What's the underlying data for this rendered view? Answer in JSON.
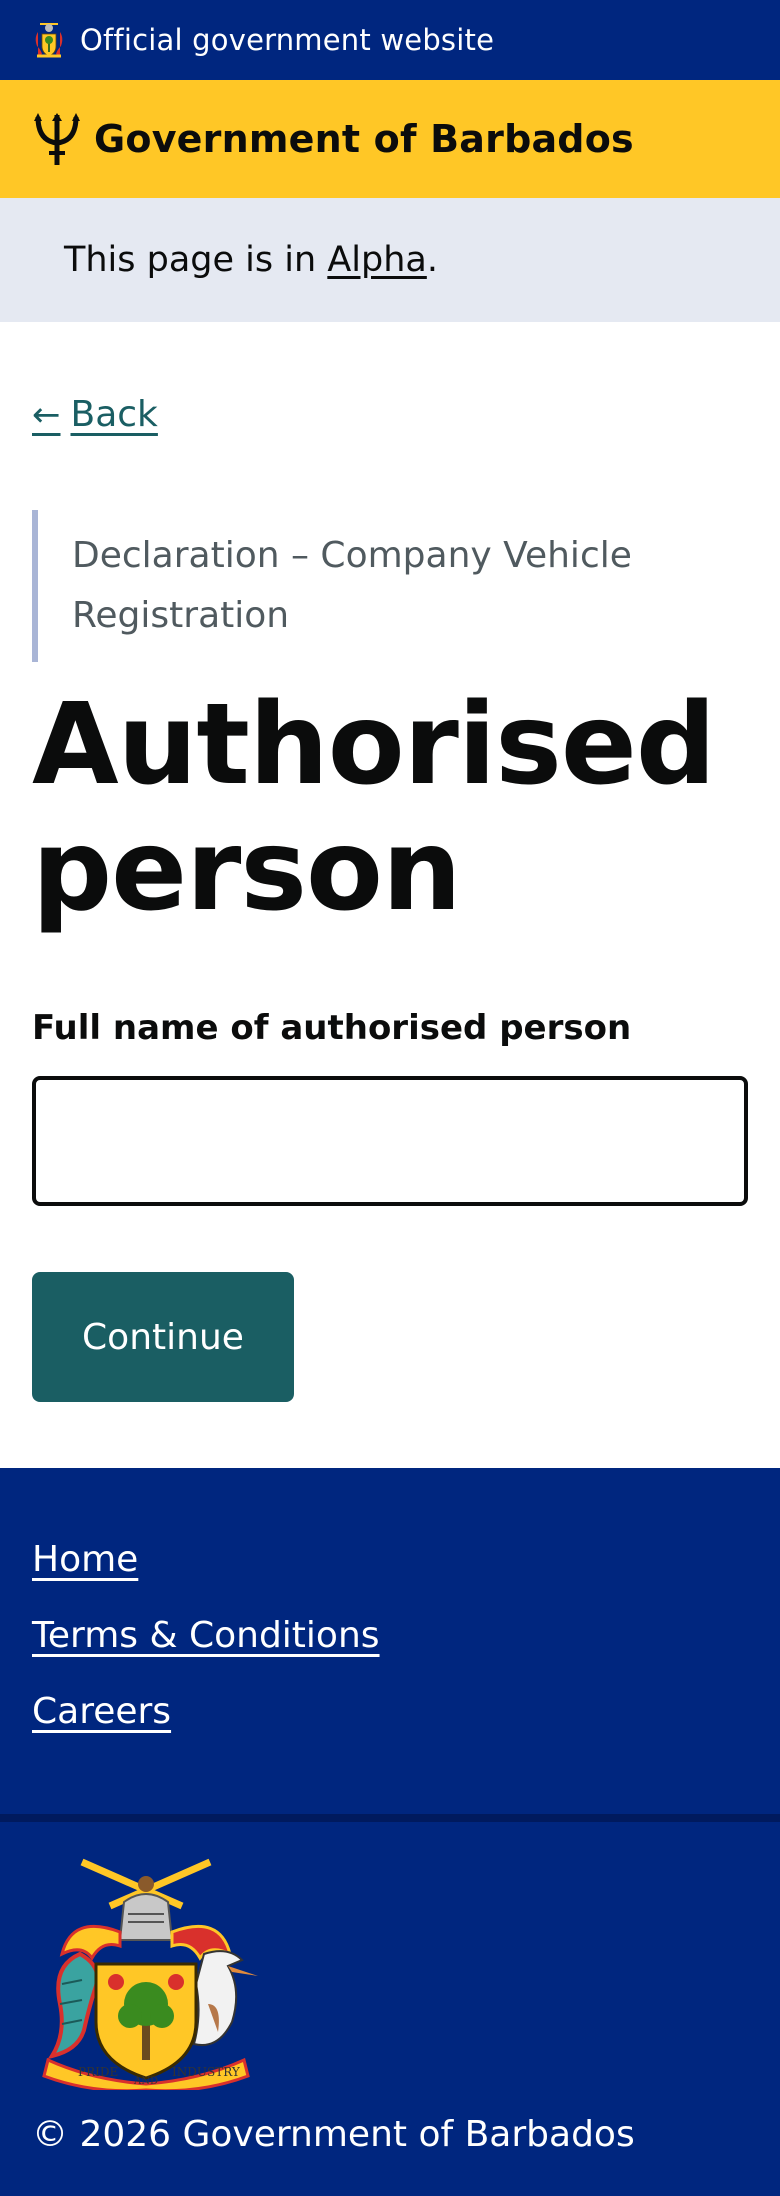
{
  "topbar": {
    "official_text": "Official government website",
    "icon": "coat-of-arms-icon"
  },
  "brand": {
    "name": "Government of Barbados",
    "icon": "trident-icon"
  },
  "phase": {
    "prefix": "This page is in ",
    "link": "Alpha",
    "suffix": "."
  },
  "back": {
    "arrow": "←",
    "label": "Back"
  },
  "form": {
    "caption": "Declaration – Company Vehicle Registration",
    "title": "Authorised person",
    "field_label": "Full name of authorised person",
    "field_value": "",
    "continue_label": "Continue"
  },
  "footer": {
    "links": [
      "Home",
      "Terms & Conditions",
      "Careers"
    ],
    "motto_left": "PRIDE",
    "motto_middle": "AND",
    "motto_right": "INDUSTRY",
    "copyright": "© 2026 Government of Barbados"
  },
  "colors": {
    "navy": "#00267f",
    "gold": "#ffc726",
    "teal": "#1a5e63",
    "phase_bg": "#e5e9f2"
  }
}
